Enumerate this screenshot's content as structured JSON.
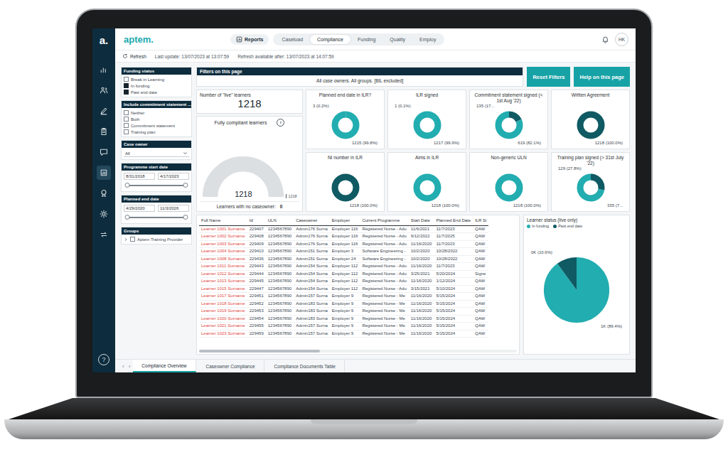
{
  "sidebar": {
    "logo": "a.",
    "help": "?",
    "items": [
      {
        "selected": false
      },
      {
        "selected": false
      },
      {
        "selected": false
      },
      {
        "selected": false
      },
      {
        "selected": false
      },
      {
        "selected": true
      },
      {
        "selected": false
      },
      {
        "selected": false
      },
      {
        "selected": false
      }
    ]
  },
  "header": {
    "brand": "aptem.",
    "section": "Reports",
    "tabs": [
      {
        "label": "Caseload",
        "selected": false
      },
      {
        "label": "Compliance",
        "selected": true
      },
      {
        "label": "Funding",
        "selected": false
      },
      {
        "label": "Quality",
        "selected": false
      },
      {
        "label": "Employ",
        "selected": false
      }
    ],
    "avatar": "HK"
  },
  "subbar": {
    "refresh": "Refresh",
    "last_update": "Last update: 13/07/2023 at 13:07:59",
    "refresh_after": "Refresh available after: 13/07/2023 at 14:07:59"
  },
  "filters": [
    {
      "kind": "checklist",
      "title": "Funding status",
      "options": [
        {
          "label": "Break in Learning",
          "checked": false
        },
        {
          "label": "In funding",
          "checked": true
        },
        {
          "label": "Past end date",
          "checked": true
        }
      ]
    },
    {
      "kind": "checklist",
      "title": "Include commitment statement ...",
      "options": [
        {
          "label": "Neither",
          "checked": false
        },
        {
          "label": "Both",
          "checked": false
        },
        {
          "label": "Commitment statement",
          "checked": false
        },
        {
          "label": "Training plan",
          "checked": false
        }
      ]
    },
    {
      "kind": "dropdown",
      "title": "Case owner",
      "value": "All"
    },
    {
      "kind": "daterange",
      "title": "Programme start date",
      "from": "8/31/2018",
      "to": "4/17/2023",
      "levels": [
        0,
        1
      ]
    },
    {
      "kind": "daterange",
      "title": "Planned end date",
      "from": "4/29/2020",
      "to": "11/3/2026",
      "levels": [
        0,
        1
      ]
    },
    {
      "kind": "tree",
      "title": "Groups",
      "options": [
        {
          "label": "Aptem Training Provider",
          "checked": false
        }
      ]
    }
  ],
  "filter_summary": {
    "title": "Filters on this page",
    "text": "All case owners. All groups. [BIL excluded]"
  },
  "buttons": [
    "Reset Filters",
    "Help on this page"
  ],
  "live_learners": {
    "title": "Number of \"live\" learners",
    "value": "1218"
  },
  "gauge": {
    "title": "Fully compliant learners",
    "info": "i",
    "value": "1218",
    "max_label": "1218",
    "level": 1
  },
  "no_caseowner": {
    "label": "Learners with no caseowner:",
    "value": "0"
  },
  "donuts": [
    {
      "title": "Planned end date in ILR?",
      "segments": [
        {
          "value": 3,
          "label": "3 (0.2%)",
          "color": "#0f5a63"
        },
        {
          "value": 1215,
          "label": "1215 (99.8%)",
          "color": "#22adb0"
        }
      ]
    },
    {
      "title": "ILR signed",
      "segments": [
        {
          "value": 1,
          "label": "1 (0.1%)",
          "color": "#0f5a63"
        },
        {
          "value": 1217,
          "label": "1217 (99.9%)",
          "color": "#22adb0"
        }
      ]
    },
    {
      "title": "Commitment statement signed (< 1st Aug '22)",
      "segments": [
        {
          "value": 135,
          "label": "135 (17...",
          "color": "#0f5a63"
        },
        {
          "value": 619,
          "label": "619 (82.1%)",
          "color": "#22adb0"
        }
      ]
    },
    {
      "title": "Written Agreement",
      "segments": [
        {
          "value": 1218,
          "label": "1218 (100.0%)",
          "color": "#0f5a63"
        }
      ]
    },
    {
      "title": "NI number in ILR",
      "segments": [
        {
          "value": 1218,
          "label": "1218 (100.0%)",
          "color": "#0f5a63"
        }
      ]
    },
    {
      "title": "Aims in ILR",
      "segments": [
        {
          "value": 1218,
          "label": "1218 (100.0%)",
          "color": "#22adb0"
        }
      ]
    },
    {
      "title": "Non-generic ULN",
      "segments": [
        {
          "value": 1218,
          "label": "1218 (100.0%)",
          "color": "#22adb0"
        }
      ]
    },
    {
      "title": "Training plan signed (> 31st July '22)",
      "segments": [
        {
          "value": 129,
          "label": "129 (27.8%)",
          "color": "#0f5a63"
        },
        {
          "value": 335,
          "label": "335 (7...",
          "color": "#22adb0"
        }
      ]
    }
  ],
  "table": {
    "columns": [
      "Full Name",
      "Id",
      "ULN",
      "Caseowner",
      "Employer",
      "Current Programme",
      "Start Date",
      "Planned End Date",
      "ILR Si"
    ],
    "rows": [
      [
        "Learner 1001 Surname",
        "229407",
        "1234567890",
        "Admin176 Surna",
        "Employer 116",
        "Registered Nurse - Adu",
        "11/6/2021",
        "11/7/2023",
        "QAW"
      ],
      [
        "Learner 1002 Surname",
        "229408",
        "1234567890",
        "Admin176 Surna",
        "Employer 116",
        "Registered Nurse - Adu",
        "9/12/2022",
        "11/7/2025",
        "QAW"
      ],
      [
        "Learner 1003 Surname",
        "229409",
        "1234567890",
        "Admin176 Surna",
        "Employer 116",
        "Registered Nurse - Adu",
        "11/16/2020",
        "11/7/2023",
        "QAW"
      ],
      [
        "Learner 1004 Surname",
        "229410",
        "1234567890",
        "Admin151 Surna",
        "Employer 3",
        "Software Engineering -",
        "10/2/2020",
        "10/28/2022",
        "QAW"
      ],
      [
        "Learner 1008 Surname",
        "229436",
        "1234567890",
        "Admin151 Surna",
        "Employer 24",
        "Software Engineering -",
        "10/2/2020",
        "10/28/2022",
        "QAW"
      ],
      [
        "Learner 1011 Surname",
        "229443",
        "1234567890",
        "Admin154 Surna",
        "Employer 112",
        "Registered Nurse - Adu",
        "11/16/2020",
        "11/7/2023",
        "QAW"
      ],
      [
        "Learner 1012 Surname",
        "229444",
        "1234567890",
        "Admin154 Surna",
        "Employer 112",
        "Registered Nurse - Adu",
        "3/25/2021",
        "5/20/2024",
        "Signe"
      ],
      [
        "Learner 1013 Surname",
        "229445",
        "1234567890",
        "Admin154 Surna",
        "Employer 112",
        "Registered Nurse - Adu",
        "11/16/2020",
        "1/12/2024",
        "QAW"
      ],
      [
        "Learner 1015 Surname",
        "229447",
        "1234567890",
        "Admin154 Surna",
        "Employer 112",
        "Registered Nurse - Adu",
        "3/15/2021",
        "5/10/2024",
        "QAW"
      ],
      [
        "Learner 1017 Surname",
        "229451",
        "1234567890",
        "Admin157 Surna",
        "Employer 9",
        "Registered Nurse - Me",
        "11/16/2020",
        "5/15/2024",
        "QAW"
      ],
      [
        "Learner 1018 Surname",
        "229452",
        "1234567890",
        "Admin183 Surna",
        "Employer 9",
        "Registered Nurse - Me",
        "11/16/2020",
        "5/15/2024",
        "QAW"
      ],
      [
        "Learner 1019 Surname",
        "229453",
        "1234567890",
        "Admin183 Surna",
        "Employer 9",
        "Registered Nurse - Me",
        "11/16/2020",
        "5/15/2024",
        "QAW"
      ],
      [
        "Learner 1020 Surname",
        "229454",
        "1234567890",
        "Admin183 Surna",
        "Employer 9",
        "Registered Nurse - Me",
        "11/16/2020",
        "5/15/2024",
        "QAW"
      ],
      [
        "Learner 1021 Surname",
        "229455",
        "1234567890",
        "Admin157 Surna",
        "Employer 9",
        "Registered Nurse - Me",
        "11/16/2020",
        "5/15/2024",
        "QAW"
      ],
      [
        "Learner 1023 Surname",
        "229459",
        "1234567890",
        "Admin157 Surna",
        "Employer 9",
        "Registered Nurse - Me",
        "11/16/2020",
        "5/15/2024",
        "QAW"
      ]
    ],
    "scroll_level": 0.38
  },
  "learner_status": {
    "title": "Learner status (live only)",
    "series": [
      {
        "label": "In funding",
        "value": 1089,
        "share_label": "1K (89.4%)",
        "color": "#22adb0"
      },
      {
        "label": "Past end date",
        "value": 129,
        "share_label": "0K (10.6%)",
        "color": "#0f5a63"
      }
    ]
  },
  "sheet_nav": [
    "‹",
    "›"
  ],
  "sheet_tabs": [
    {
      "label": "Compliance Overview",
      "selected": true
    },
    {
      "label": "Caseowner Compliance",
      "selected": false
    },
    {
      "label": "Compliance Documents Table",
      "selected": false
    }
  ]
}
